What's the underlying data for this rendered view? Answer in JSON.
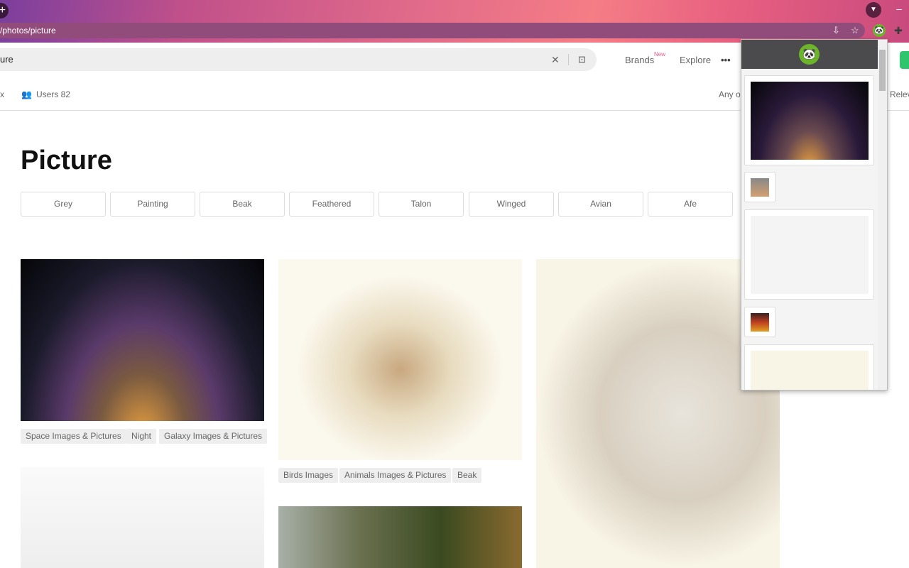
{
  "browser": {
    "url": "/photos/picture",
    "new_tab_icon": "plus-icon",
    "profile_icon": "profile-icon"
  },
  "header": {
    "search_value": "ure",
    "nav": [
      {
        "label": "Brands",
        "badge": "New"
      },
      {
        "label": "Explore"
      },
      {
        "label": "•••"
      }
    ]
  },
  "subnav": {
    "left_partial": "x",
    "users_label": "Users 82",
    "any_partial": "Any o",
    "relevance_partial": "Relev"
  },
  "page": {
    "title": "Picture",
    "chips": [
      "Grey",
      "Painting",
      "Beak",
      "Feathered",
      "Talon",
      "Winged",
      "Avian",
      "Afe"
    ]
  },
  "results": {
    "col1_tags": [
      "Space Images & Pictures",
      "Night",
      "Galaxy Images & Pictures"
    ],
    "col2_tags": [
      "Birds Images",
      "Animals Images & Pictures",
      "Beak"
    ]
  },
  "colors": {
    "accent_green": "#2ec66d",
    "popup_header": "#4b4a4c",
    "panda_green": "#6cb52a"
  }
}
